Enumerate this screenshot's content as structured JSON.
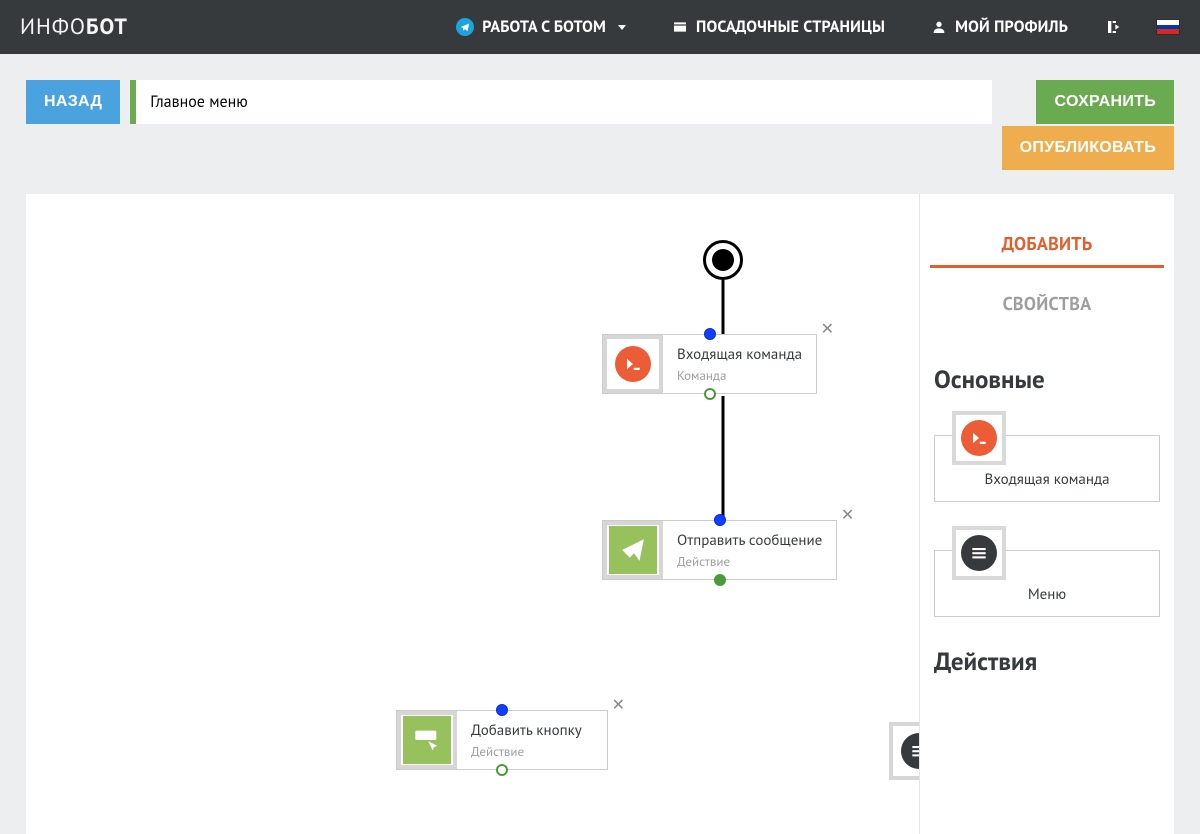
{
  "brand": {
    "thin": "ИНФО",
    "bold": "БОТ"
  },
  "nav": {
    "bot": "РАБОТА С БОТОМ",
    "landing": "ПОСАДОЧНЫЕ СТРАНИЦЫ",
    "profile": "МОЙ ПРОФИЛЬ"
  },
  "toolbar": {
    "back": "НАЗАД",
    "title_value": "Главное меню",
    "save": "СОХРАНИТЬ",
    "publish": "ОПУБЛИКОВАТЬ"
  },
  "sidebar": {
    "tab_add": "ДОБАВИТЬ",
    "tab_props": "СВОЙСТВА",
    "section_main": "Основные",
    "section_actions": "Действия",
    "item_command": "Входящая команда",
    "item_menu": "Меню"
  },
  "nodes": {
    "n1": {
      "title": "Входящая команда",
      "subtitle": "Команда"
    },
    "n2": {
      "title": "Отправить сообщение",
      "subtitle": "Действие"
    },
    "n3": {
      "title": "Добавить кнопку",
      "subtitle": "Действие"
    }
  }
}
